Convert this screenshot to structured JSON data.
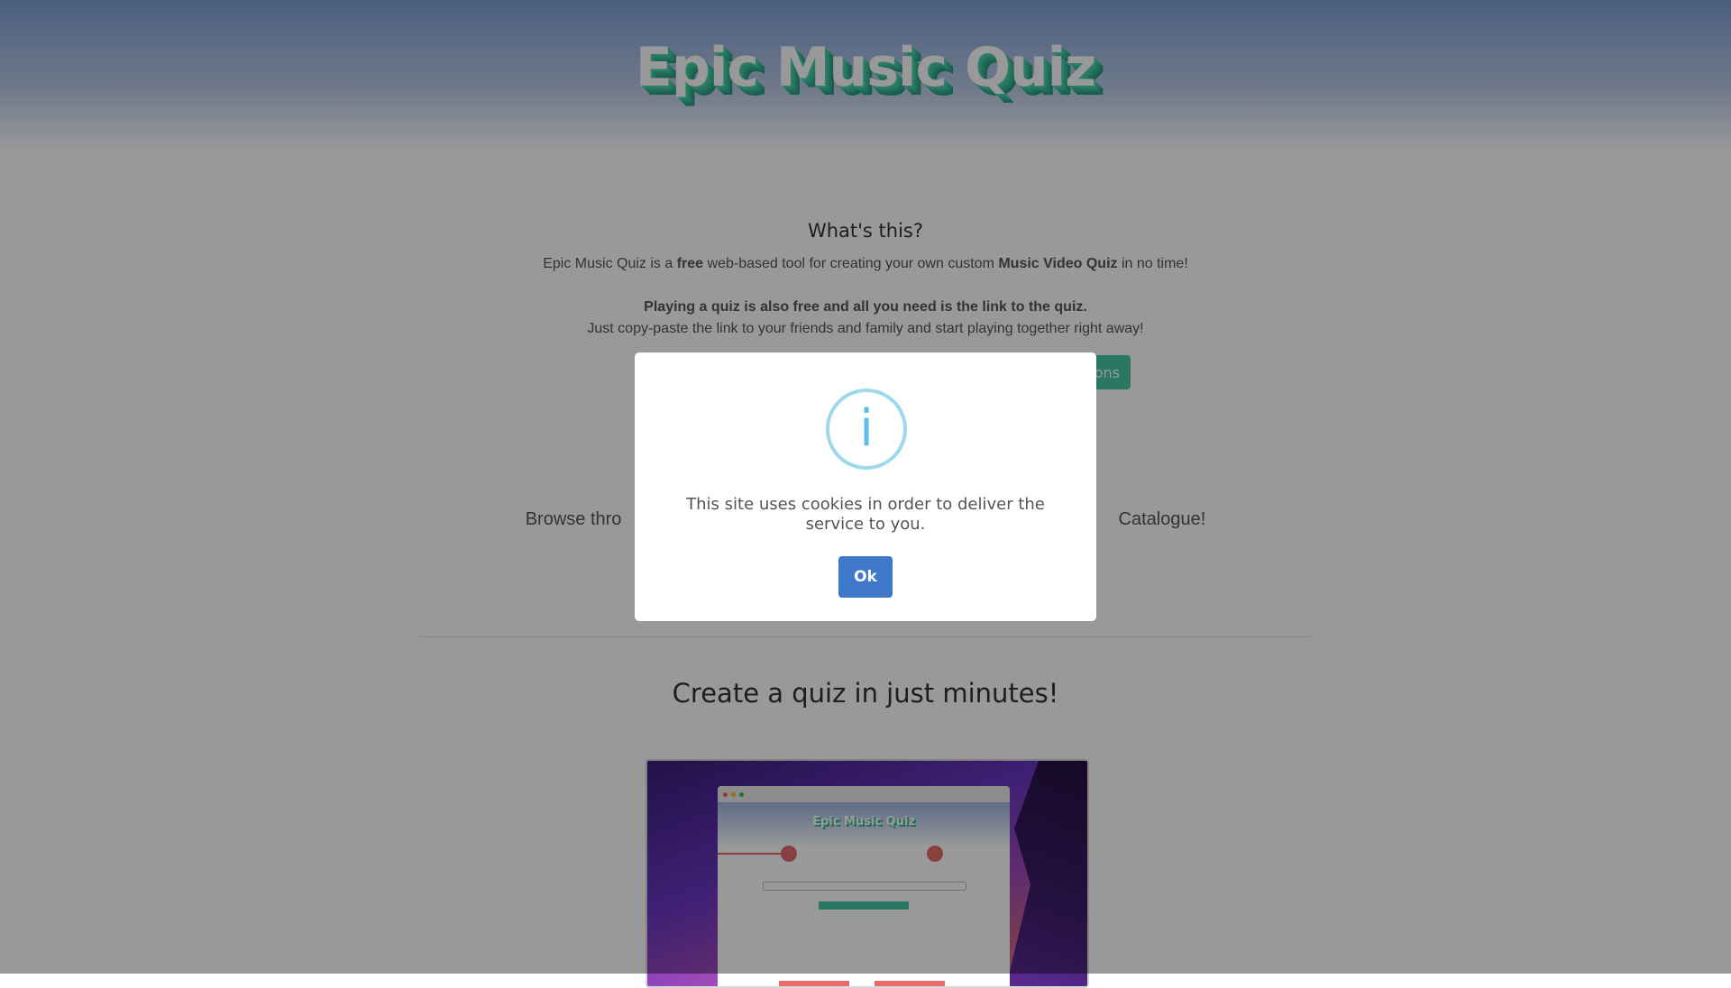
{
  "header": {
    "logo_text": "Epic Music Quiz"
  },
  "intro": {
    "title": "What's this?",
    "line1_parts": [
      "Epic Music Quiz is a ",
      "free",
      " web-based tool for creating your own custom ",
      "Music Video Quiz",
      " in no time!"
    ],
    "line2": "Playing a quiz is also free and all you need is the link to the quiz.",
    "line3": "Just copy-paste the link to your friends and family and start playing together right away!",
    "partial_button_label": "ons"
  },
  "browse": {
    "text_left": "Browse thro",
    "text_right": "Catalogue!"
  },
  "create": {
    "title": "Create a quiz in just minutes!"
  },
  "preview": {
    "logo_text": "Epic Music Quiz"
  },
  "modal": {
    "icon": "info-icon",
    "icon_glyph": "i",
    "message": "This site uses cookies in order to deliver the service to you.",
    "ok_label": "Ok"
  },
  "colors": {
    "hero_top": "#7d9fd6",
    "logo_shadow": "#2fa888",
    "accent_green": "#48c9a4",
    "ok_button": "#3f78c8",
    "info_icon": "#5bc0e6"
  }
}
